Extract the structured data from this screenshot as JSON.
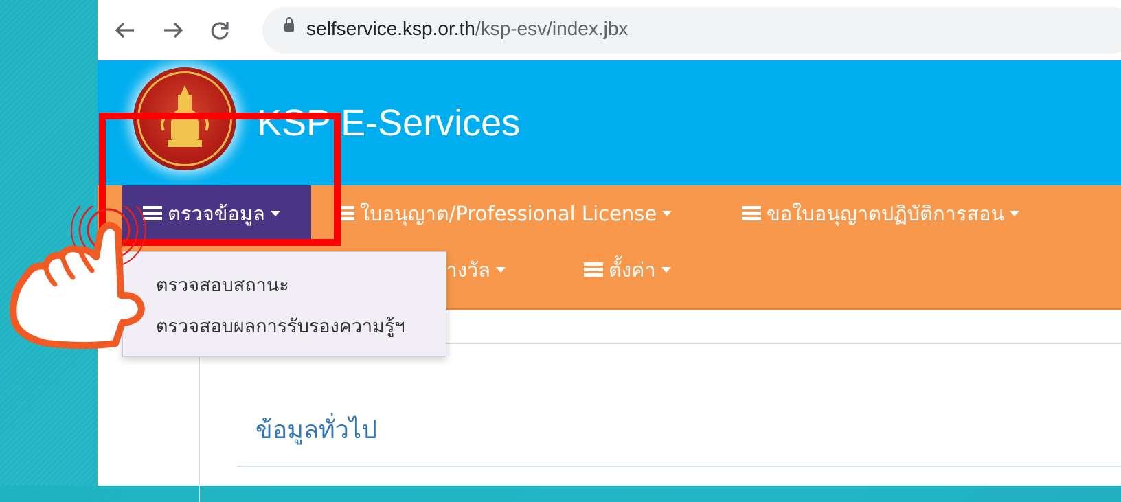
{
  "browser": {
    "url_host": "selfservice.ksp.or.th",
    "url_path": "/ksp-esv/index.jbx",
    "back_icon": "arrow-left-icon",
    "forward_icon": "arrow-right-icon",
    "reload_icon": "reload-icon"
  },
  "header": {
    "title": "KSP E-Services",
    "logo": "ksp-seal-logo"
  },
  "nav": {
    "items": [
      {
        "label": "ตรวจข้อมูล"
      },
      {
        "label": "ใบอนุญาต/Professional License"
      },
      {
        "label": "ขอใบอนุญาตปฏิบัติการสอน"
      },
      {
        "label": "รับรางวัล"
      },
      {
        "label": "ตั้งค่า"
      }
    ]
  },
  "dropdown": {
    "items": [
      {
        "label": "ตรวจสอบสถานะ"
      },
      {
        "label": "ตรวจสอบผลการรับรองความรู้ฯ"
      }
    ]
  },
  "content": {
    "section_title": "ข้อมูลทั่วไป"
  },
  "colors": {
    "header_bg": "#00aeef",
    "nav_bg": "#f7984c",
    "active_nav_bg": "#4a3584",
    "highlight": "#ff0000",
    "section_title": "#3476b5"
  }
}
